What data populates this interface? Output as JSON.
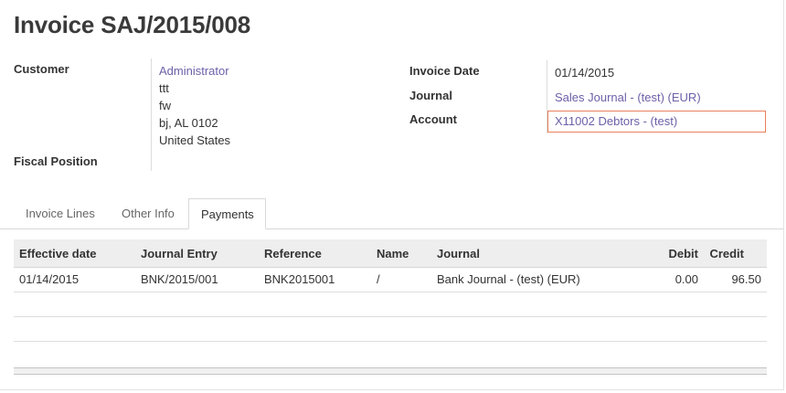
{
  "invoice": {
    "title": "Invoice SAJ/2015/008"
  },
  "customer": {
    "label": "Customer",
    "name": "Administrator",
    "address": [
      "ttt",
      "fw",
      "bj, AL 0102",
      "United States"
    ]
  },
  "fiscal_position": {
    "label": "Fiscal Position"
  },
  "invoice_date": {
    "label": "Invoice Date",
    "value": "01/14/2015"
  },
  "journal": {
    "label": "Journal",
    "value": "Sales Journal - (test) (EUR)"
  },
  "account": {
    "label": "Account",
    "value": "X11002 Debtors - (test)"
  },
  "tabs": [
    {
      "label": "Invoice Lines",
      "active": false
    },
    {
      "label": "Other Info",
      "active": false
    },
    {
      "label": "Payments",
      "active": true
    }
  ],
  "payments": {
    "columns": [
      "Effective date",
      "Journal Entry",
      "Reference",
      "Name",
      "Journal",
      "Debit",
      "Credit"
    ],
    "rows": [
      [
        "01/14/2015",
        "BNK/2015/001",
        "BNK2015001",
        "/",
        "Bank Journal - (test) (EUR)",
        "0.00",
        "96.50"
      ]
    ]
  }
}
